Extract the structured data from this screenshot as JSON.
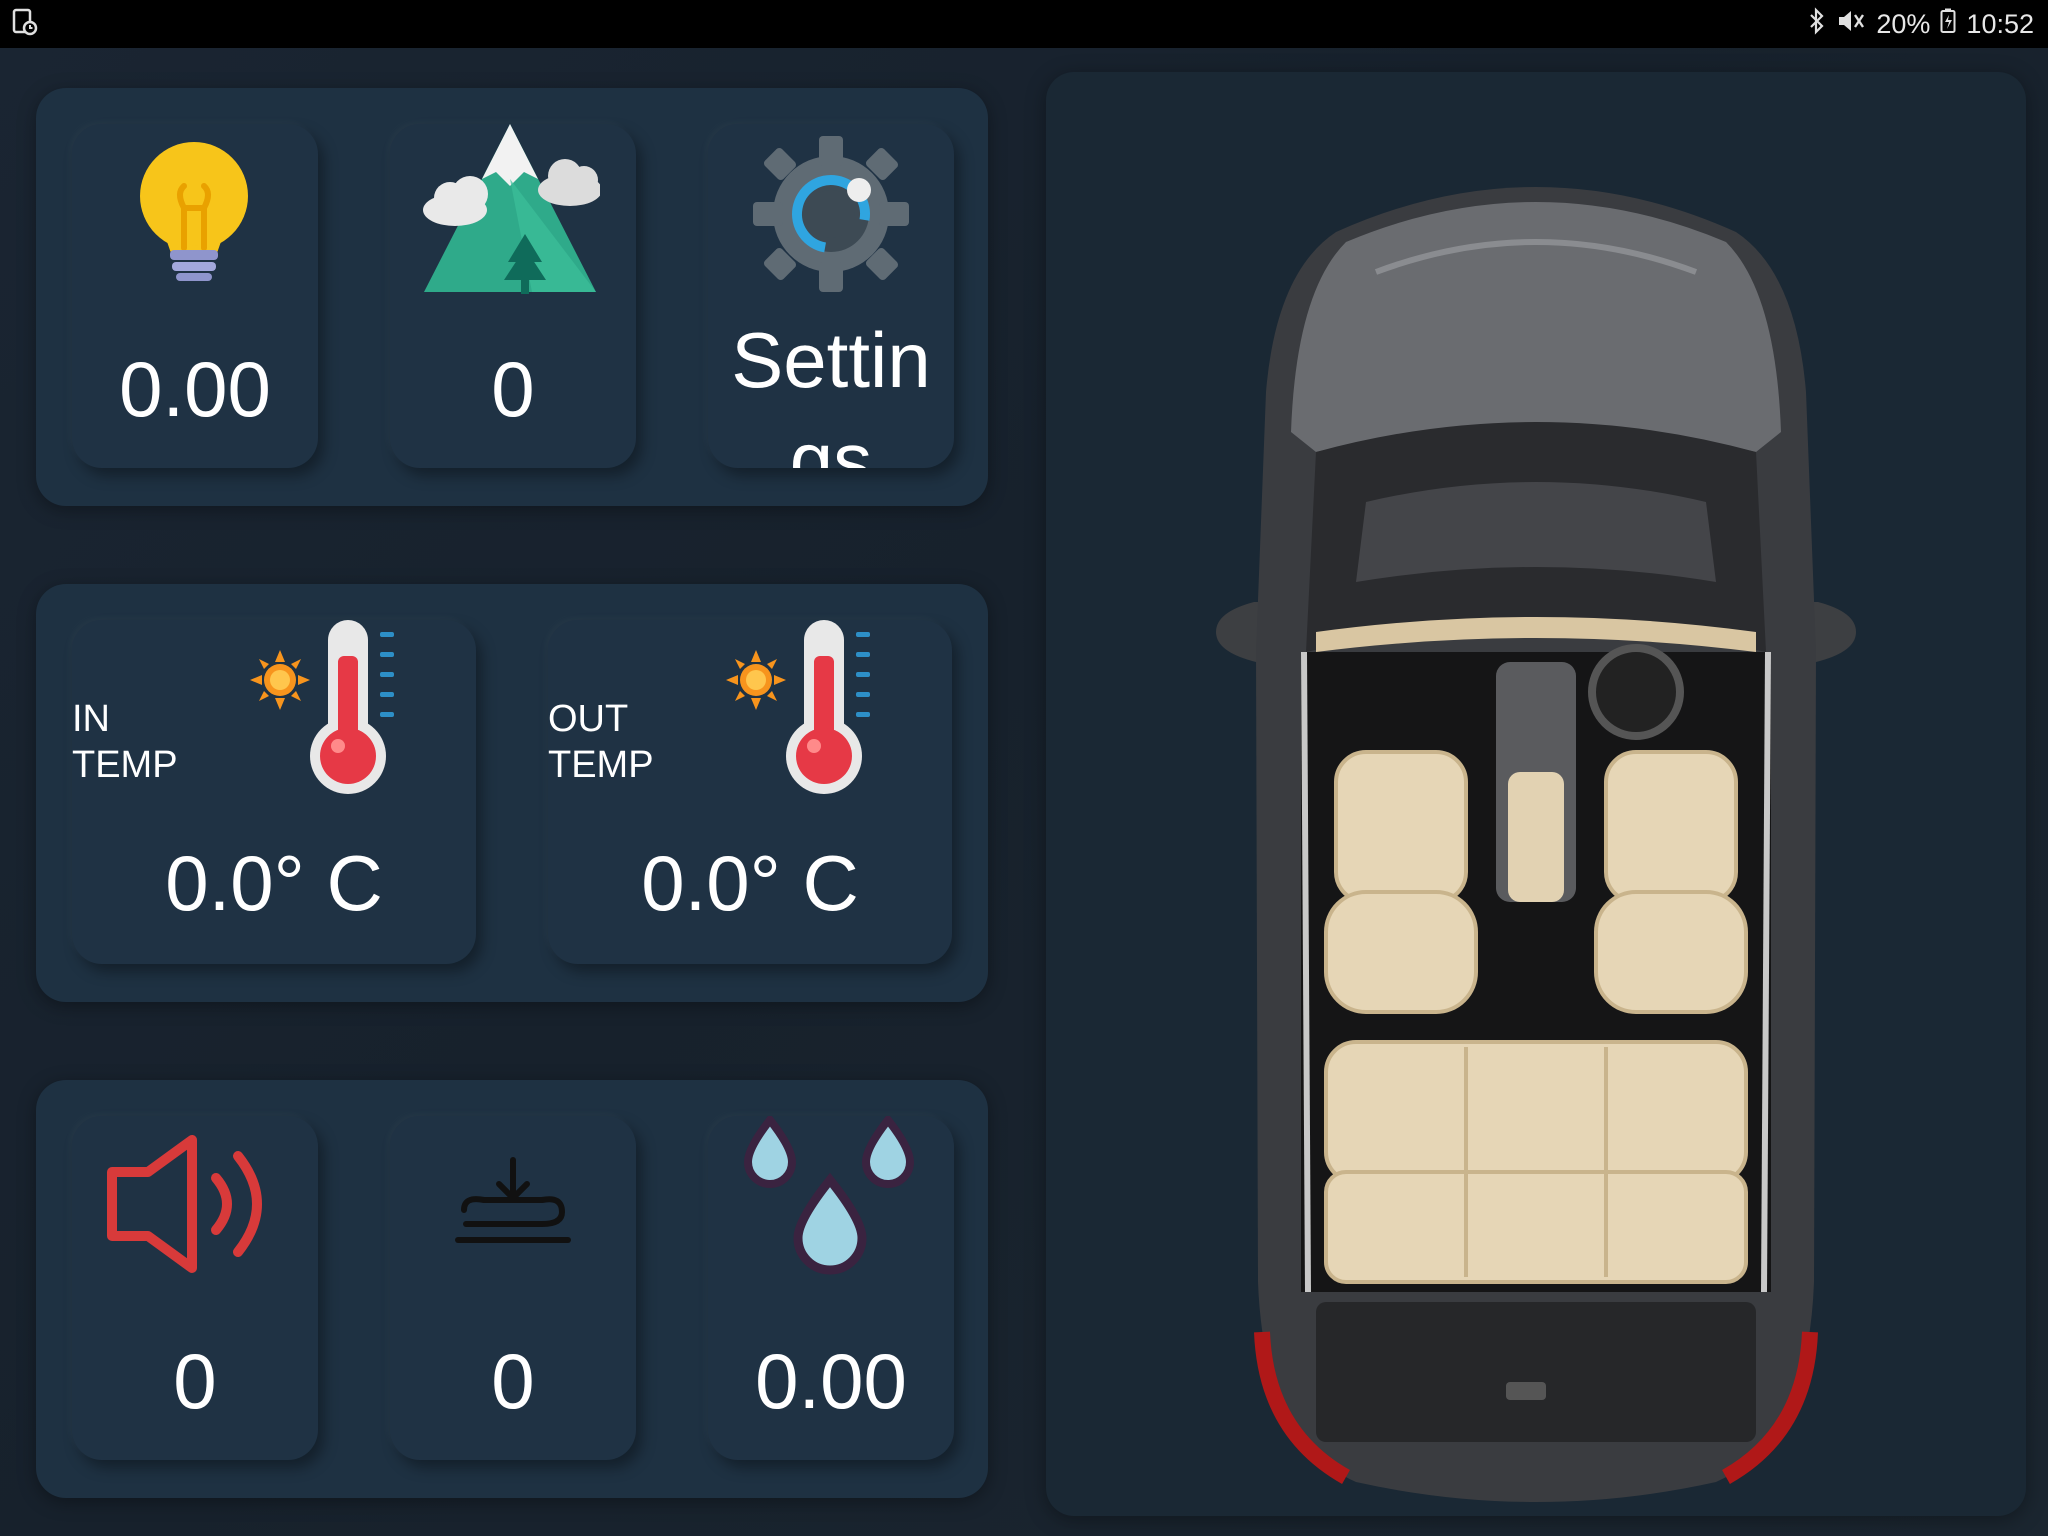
{
  "status_bar": {
    "left_icon": "screenshot-notification-icon",
    "bluetooth_icon": "bluetooth-icon",
    "mute_icon": "vibrate-mute-icon",
    "battery_percent": "20%",
    "battery_icon": "battery-charging-icon",
    "time": "10:52"
  },
  "top_panel": {
    "light_value": "0.00",
    "altitude_value": "0",
    "settings_label": "Settin\ngs"
  },
  "temp_panel": {
    "in_label": "IN\nTEMP",
    "in_value": "0.0° C",
    "out_label": "OUT\nTEMP",
    "out_value": "0.0° C"
  },
  "bottom_panel": {
    "sound_value": "0",
    "pressure_value": "0",
    "humidity_value": "0.00"
  },
  "colors": {
    "background": "#17212c",
    "panel": "#1e3142",
    "bulb": "#f7c51a",
    "thermometer_red": "#e63946",
    "sun": "#f7941d",
    "speaker_red": "#d83a3a",
    "droplet": "#9fd3e3"
  }
}
